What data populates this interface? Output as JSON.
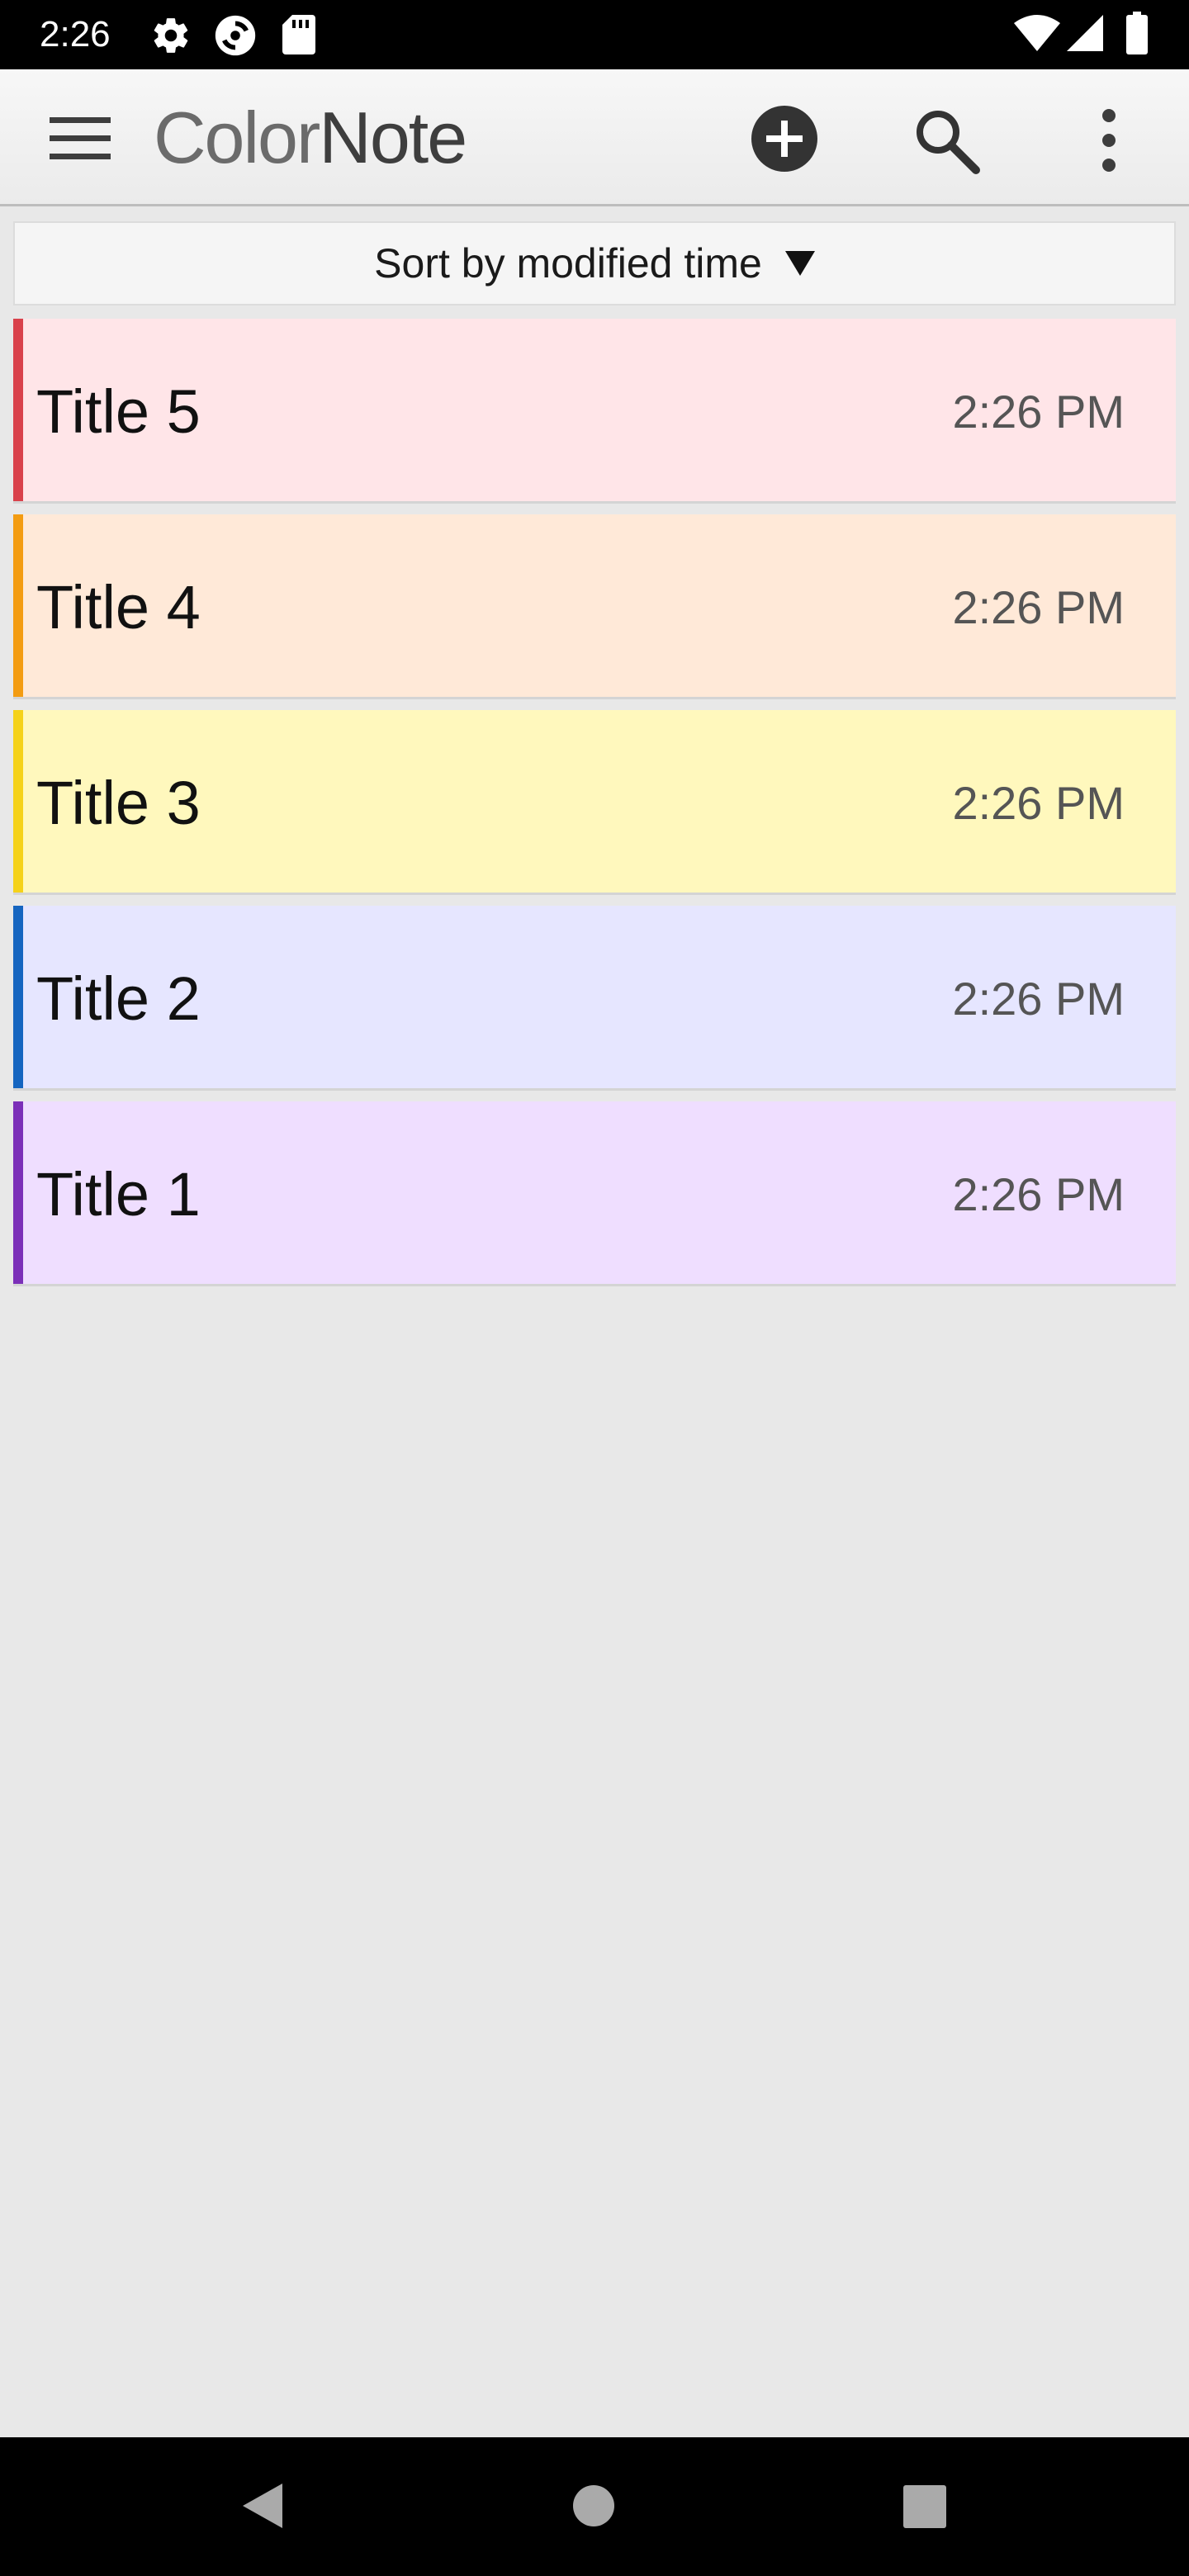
{
  "status_bar": {
    "time": "2:26",
    "icons": [
      "gear-icon",
      "sync-icon",
      "sd-card-icon",
      "wifi-icon",
      "signal-icon",
      "battery-icon"
    ]
  },
  "app_bar": {
    "logo_prefix": "Color",
    "logo_suffix": "Note",
    "icons": [
      "menu-icon",
      "add-icon",
      "search-icon",
      "more-vert-icon"
    ]
  },
  "sort": {
    "label": "Sort by modified time"
  },
  "notes": [
    {
      "title": "Title 5",
      "time": "2:26 PM",
      "bg": "#ffe5e8",
      "accent": "#d9414b"
    },
    {
      "title": "Title 4",
      "time": "2:26 PM",
      "bg": "#ffe9d8",
      "accent": "#f39c12"
    },
    {
      "title": "Title 3",
      "time": "2:26 PM",
      "bg": "#fff8bd",
      "accent": "#f5d21a"
    },
    {
      "title": "Title 2",
      "time": "2:26 PM",
      "bg": "#e6e6ff",
      "accent": "#1565c0"
    },
    {
      "title": "Title 1",
      "time": "2:26 PM",
      "bg": "#efdeff",
      "accent": "#7b2fb8"
    }
  ],
  "nav_bar": {
    "icons": [
      "back-icon",
      "home-icon",
      "recents-icon"
    ]
  }
}
